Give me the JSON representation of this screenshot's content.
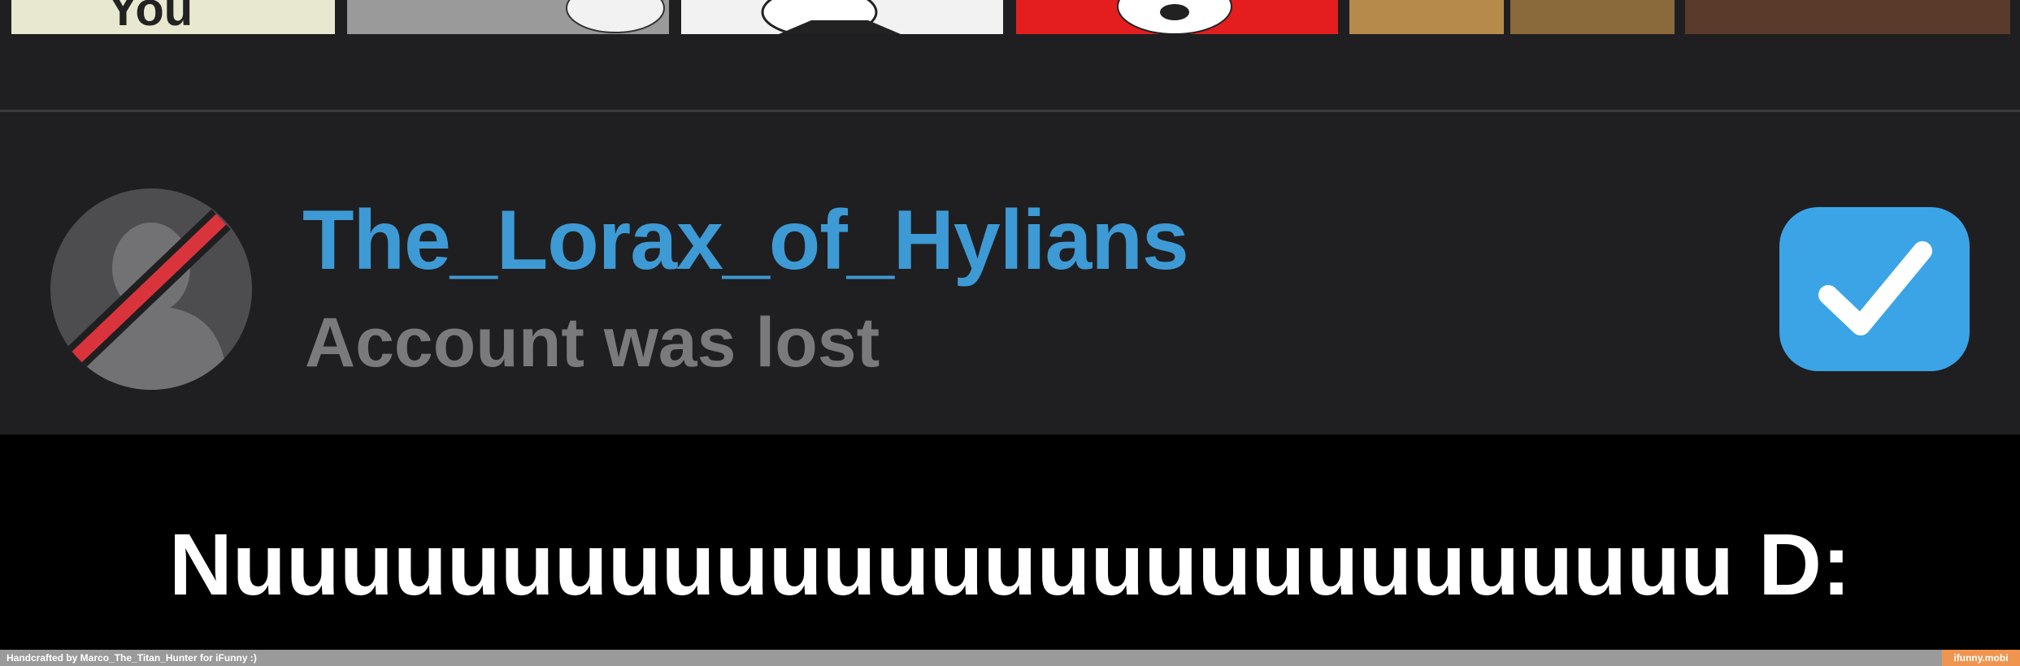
{
  "thumbnails": {
    "first_text": "You",
    "colors": [
      "#e8e8d0",
      "#9a9a9a",
      "#f2f2f2",
      "#e41e1e",
      "#b58a4a",
      "#8a6a3a",
      "#5a3a2a"
    ]
  },
  "user": {
    "username": "The_Lorax_of_Hylians",
    "status": "Account was lost",
    "checked": true
  },
  "caption": {
    "text": "Nuuuuuuuuuuuuuuuuuuuuuuuuuuuu D:"
  },
  "footer": {
    "credit": "Handcrafted by Marco_The_Titan_Hunter for iFunny :)",
    "watermark": "ifunny.mobi"
  },
  "colors": {
    "accent": "#3d9ad4",
    "checkbox": "#3ba4e6",
    "status_text": "#7a7a7c",
    "watermark_bg": "#f0954f"
  },
  "icons": {
    "avatar": "deleted-user-icon",
    "checkbox": "checkmark-icon"
  }
}
